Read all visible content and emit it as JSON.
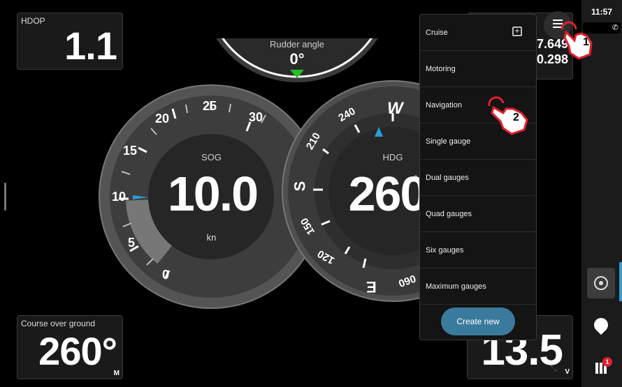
{
  "status": {
    "time": "11:57"
  },
  "tiles": {
    "hdop": {
      "label": "HDOP",
      "value": "1.1"
    },
    "cog": {
      "label": "Course over ground",
      "value": "260°",
      "unit": "M"
    },
    "pos": {
      "line1": "7.649",
      "line2": "0.298"
    },
    "voltage": {
      "value": "13.5",
      "unit": "V"
    }
  },
  "rudder": {
    "label": "Rudder angle",
    "value": "0°"
  },
  "sog": {
    "label": "SOG",
    "value": "10.0",
    "unit": "kn",
    "ticks": [
      "0",
      "5",
      "10",
      "15",
      "20",
      "25",
      "30"
    ]
  },
  "hdg": {
    "label": "HDG",
    "value": "260",
    "degree": "°",
    "ticks": [
      "W",
      "240",
      "210",
      "S",
      "150",
      "120",
      "E",
      "060"
    ]
  },
  "menu": {
    "items": [
      "Cruise",
      "Motoring",
      "Navigation",
      "Single gauge",
      "Dual gauges",
      "Quad gauges",
      "Six gauges",
      "Maximum gauges"
    ],
    "create_label": "Create new"
  },
  "annotations": {
    "step1": "1",
    "step2": "2"
  },
  "notifications": {
    "badge": "1"
  },
  "colors": {
    "accent": "#2f9bd7",
    "rudder_marker": "#22c02a",
    "create_button": "#3a7a9c",
    "annotation": "#e0202c"
  },
  "icons": [
    "hamburger-menu-icon",
    "add-page-icon",
    "autopilot-icon",
    "add-waypoint-icon",
    "apps-grid-icon",
    "pointing-hand-icon",
    "satellite-status-icon",
    "fullscreen-icon"
  ]
}
